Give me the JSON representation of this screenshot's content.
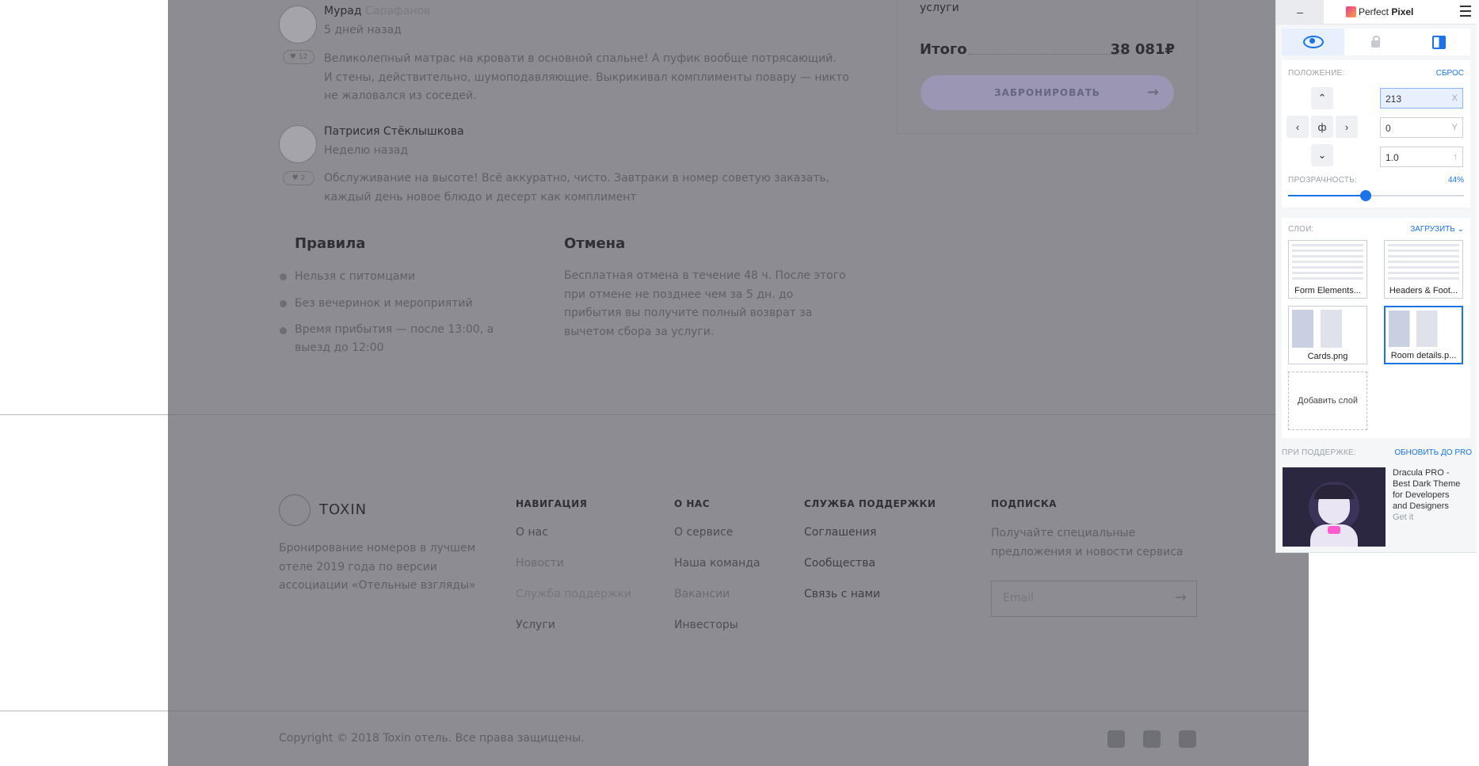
{
  "reviews": [
    {
      "first": "Мурад",
      "last": "Сарафанов",
      "time": "5 дней назад",
      "likes": "12",
      "text1": "Великолепный матрас на кровати в основной спальне! А пуфик вообще потрясающий.",
      "text2": "И стены, действительно, шумоподавляющие. Выкрикивал комплименты повару — никто",
      "text3": "не жаловался из соседей."
    },
    {
      "name": "Патрисия Стёклышкова",
      "time": "Неделю назад",
      "likes": "2",
      "text1": "Обслуживание на высоте! Всё аккуратно, чисто. Завтраки в номер советую заказать,",
      "text2": "каждый день новое блюдо и десерт как комплимент"
    }
  ],
  "rules": {
    "title": "Правила",
    "items": [
      "Нельзя с питомцами",
      "Без вечеринок и мероприятий",
      "Время прибытия — после 13:00, а",
      "выезд до 12:00"
    ]
  },
  "cancel": {
    "title": "Отмена",
    "lines": [
      "Бесплатная отмена в течение 48 ч. После этого",
      "при отмене не позднее чем за 5 дн. до",
      "прибытия вы получите полный возврат за",
      "вычетом сбора за услуги."
    ]
  },
  "booking": {
    "services_tail": "услуги",
    "total_label": "Итого",
    "total_value": "38 081₽",
    "button": "ЗАБРОНИРОВАТЬ"
  },
  "footer": {
    "logo": "TOXIN",
    "about": [
      "Бронирование номеров в лучшем",
      "отеле 2019 года по версии",
      "ассоциации «Отельные взгляды»"
    ],
    "nav": {
      "title": "НАВИГАЦИЯ",
      "items": [
        "О нас",
        "Новости",
        "Служба поддержки",
        "Услуги"
      ]
    },
    "about_us": {
      "title": "О НАС",
      "items": [
        "О сервисе",
        "Наша команда",
        "Вакансии",
        "Инвесторы"
      ]
    },
    "support": {
      "title": "СЛУЖБА ПОДДЕРЖКИ",
      "items": [
        "Соглашения",
        "Сообщества",
        "Связь с нами"
      ]
    },
    "subscribe": {
      "title": "ПОДПИСКА",
      "text": [
        "Получайте специальные",
        "предложения и новости сервиса"
      ],
      "placeholder": "Email"
    },
    "copyright": "Copyright © 2018 Toxin отель. Все права защищены."
  },
  "perfect_pixel": {
    "minimize": "–",
    "title_a": "Perfect ",
    "title_b": "Pixel",
    "position_label": "ПОЛОЖЕНИЕ:",
    "reset": "СБРОС",
    "x_value": "213",
    "x_suffix": "X",
    "y_value": "0",
    "y_suffix": "Y",
    "scale_value": "1.0",
    "scale_suffix": "↑",
    "opacity_label": "ПРОЗРАЧНОСТЬ:",
    "opacity_value": "44%",
    "opacity_fraction": 0.44,
    "layers_label": "СЛОИ:",
    "upload": "ЗАГРУЗИТЬ",
    "layers": [
      "Form Elements...",
      "Headers & Foot...",
      "Cards.png",
      "Room details.p..."
    ],
    "add_layer": "Добавить слой",
    "support_label": "ПРИ ПОДДЕРЖКЕ:",
    "upgrade": "ОБНОВИТЬ ДО PRO",
    "ad_text": [
      "Dracula PRO -",
      "Best Dark Theme",
      "for Developers",
      "and Designers"
    ],
    "ad_link": "Get it"
  },
  "colors": {
    "overlay": "#8c8c92",
    "accent": "#1a73e8",
    "brand": "#e83e8c"
  }
}
